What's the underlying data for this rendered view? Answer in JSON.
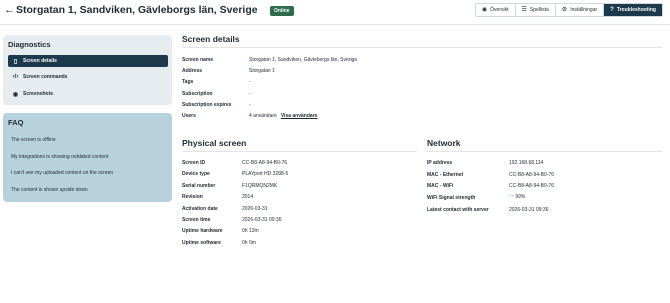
{
  "header": {
    "back_icon": "arrow-left-icon",
    "title": "Storgatan 1, Sandviken, Gävleborgs län, Sverige",
    "status": "Online",
    "status_color": "#2f6b4d",
    "tabs": [
      {
        "label": "Översikt",
        "icon": "eye-icon"
      },
      {
        "label": "Spellista",
        "icon": "playlist-icon"
      },
      {
        "label": "Inställningar",
        "icon": "gear-icon"
      },
      {
        "label": "Troubleshooting",
        "icon": "help-circle-icon",
        "active": true
      }
    ],
    "active_tab_color": "#1d3a4d"
  },
  "diagnostics": {
    "title": "Diagnostics",
    "items": [
      {
        "label": "Screen details",
        "icon": "screen-icon",
        "active": true
      },
      {
        "label": "Screen commands",
        "icon": "code-icon"
      },
      {
        "label": "Screenshots",
        "icon": "eye-icon"
      }
    ]
  },
  "faq": {
    "title": "FAQ",
    "items": [
      "The screen is offline",
      "My integrations is showing outdated content",
      "I can't see my uploaded content on the screen",
      "The content is shown upside down"
    ]
  },
  "screen_details": {
    "title": "Screen details",
    "rows": [
      {
        "label": "Screen name",
        "value": "Storgatan 1, Sandviken, Gävleborgs län, Sverige"
      },
      {
        "label": "Address",
        "value": "Storgatan 1"
      },
      {
        "label": "Tags",
        "value": "-"
      },
      {
        "label": "Subscription",
        "value": "-"
      },
      {
        "label": "Subscription expires",
        "value": "-"
      },
      {
        "label": "Users",
        "value": "4 användare",
        "link": "Visa användare"
      }
    ]
  },
  "physical_screen": {
    "title": "Physical screen",
    "rows": [
      {
        "label": "Screen ID",
        "value": "CC-B8-A8-94-B0-76"
      },
      {
        "label": "Device type",
        "value": "PLAYport HD 3288-5"
      },
      {
        "label": "Serial number",
        "value": "F1QRMQN2MK"
      },
      {
        "label": "Revision",
        "value": "2014"
      },
      {
        "label": "Activation date",
        "value": "2026-03-31"
      },
      {
        "label": "Screen time",
        "value": "2026-03-31 09:36"
      },
      {
        "label": "Uptime hardware",
        "value": "0h 13m"
      },
      {
        "label": "Uptime software",
        "value": "0h 0m"
      }
    ]
  },
  "network": {
    "title": "Network",
    "rows": [
      {
        "label": "IP address",
        "value": "192.168.68.114"
      },
      {
        "label": "MAC - Ethernet",
        "value": "CC-B8-A8-94-B0-76"
      },
      {
        "label": "MAC - WiFi",
        "value": "CC-B8-A8-94-B0-76"
      },
      {
        "label": "WiFi Signal strength",
        "value": "99%",
        "icon": "wifi-icon",
        "icon_color": "#27a36a"
      },
      {
        "label": "Latest contact with server",
        "value": "2026-03-31 09:36"
      }
    ]
  }
}
